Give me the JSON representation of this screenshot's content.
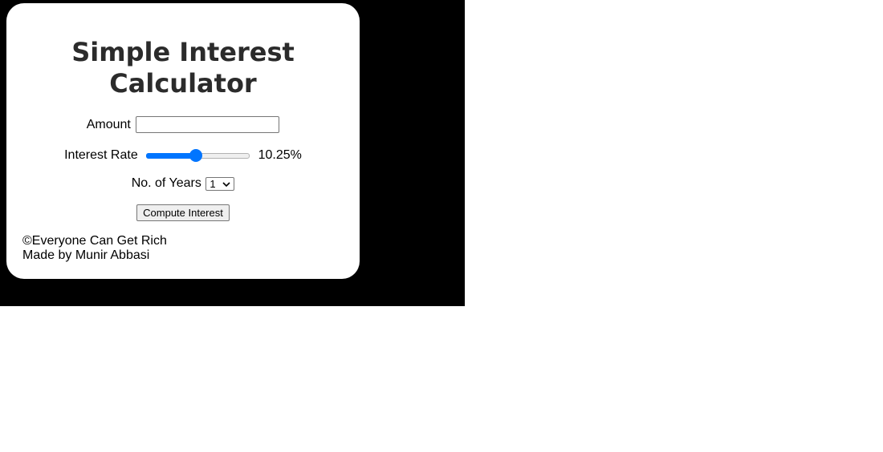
{
  "calculator": {
    "title": "Simple Interest Calculator",
    "amount": {
      "label": "Amount",
      "value": ""
    },
    "interest_rate": {
      "label": "Interest Rate",
      "value_text": "10.25%",
      "fraction": 0.48,
      "accent_color": "#0075ff"
    },
    "years": {
      "label": "No. of Years",
      "selected": "1"
    },
    "compute_button_label": "Compute Interest",
    "footer": {
      "copyright": "©Everyone Can Get Rich",
      "credit": "Made by Munir Abbasi"
    }
  }
}
